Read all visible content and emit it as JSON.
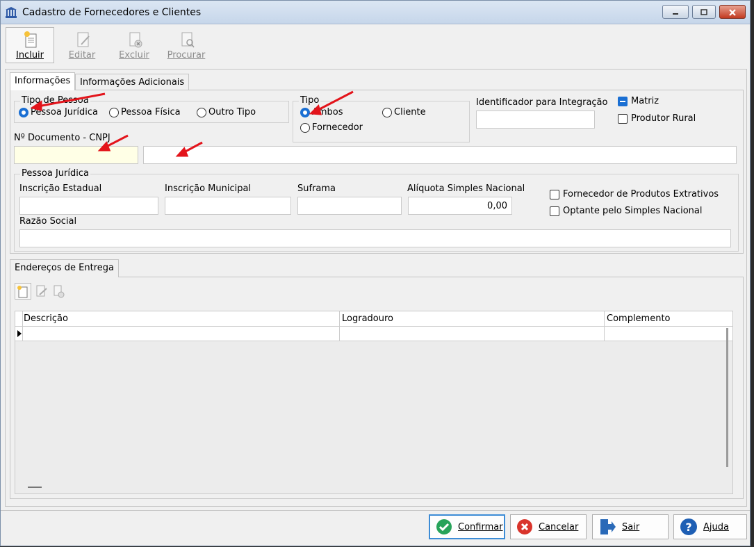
{
  "window": {
    "title": "Cadastro de Fornecedores e Clientes"
  },
  "toolbar": {
    "incluir": "Incluir",
    "editar": "Editar",
    "excluir": "Excluir",
    "procurar": "Procurar"
  },
  "tabs": {
    "informacoes": "Informações",
    "adicionais": "Informações Adicionais"
  },
  "tipo_pessoa": {
    "title": "Tipo de Pessoa",
    "options": [
      "Pessoa Jurídica",
      "Pessoa Física",
      "Outro Tipo"
    ],
    "selected": "Pessoa Jurídica"
  },
  "tipo": {
    "title": "Tipo",
    "options": [
      "Ambos",
      "Cliente",
      "Fornecedor"
    ],
    "selected": "Ambos"
  },
  "identificador": {
    "label": "Identificador para Integração",
    "value": ""
  },
  "checks_top": {
    "matriz": "Matriz",
    "produtor_rural": "Produtor Rural"
  },
  "documento": {
    "label": "Nº Documento - CNPJ",
    "value": "",
    "description": ""
  },
  "pessoa_juridica": {
    "title": "Pessoa Jurídica",
    "inscricao_estadual": "Inscrição Estadual",
    "inscricao_municipal": "Inscrição Municipal",
    "suframa": "Suframa",
    "aliquota_label": "Alíquota Simples Nacional",
    "aliquota_value": "0,00",
    "razao_social": "Razão Social",
    "fornecedor_extrativos": "Fornecedor de Produtos Extrativos",
    "optante_simples": "Optante pelo Simples Nacional"
  },
  "enderecos": {
    "tab": "Endereços de Entrega",
    "columns": [
      "Descrição",
      "Logradouro",
      "Complemento"
    ]
  },
  "footer": {
    "confirmar": "Confirmar",
    "cancelar": "Cancelar",
    "sair": "Sair",
    "ajuda": "Ajuda"
  },
  "colors": {
    "accent": "#1a6fd3",
    "annotation_arrow": "#e3141b",
    "required_field": "#ffffe6"
  }
}
